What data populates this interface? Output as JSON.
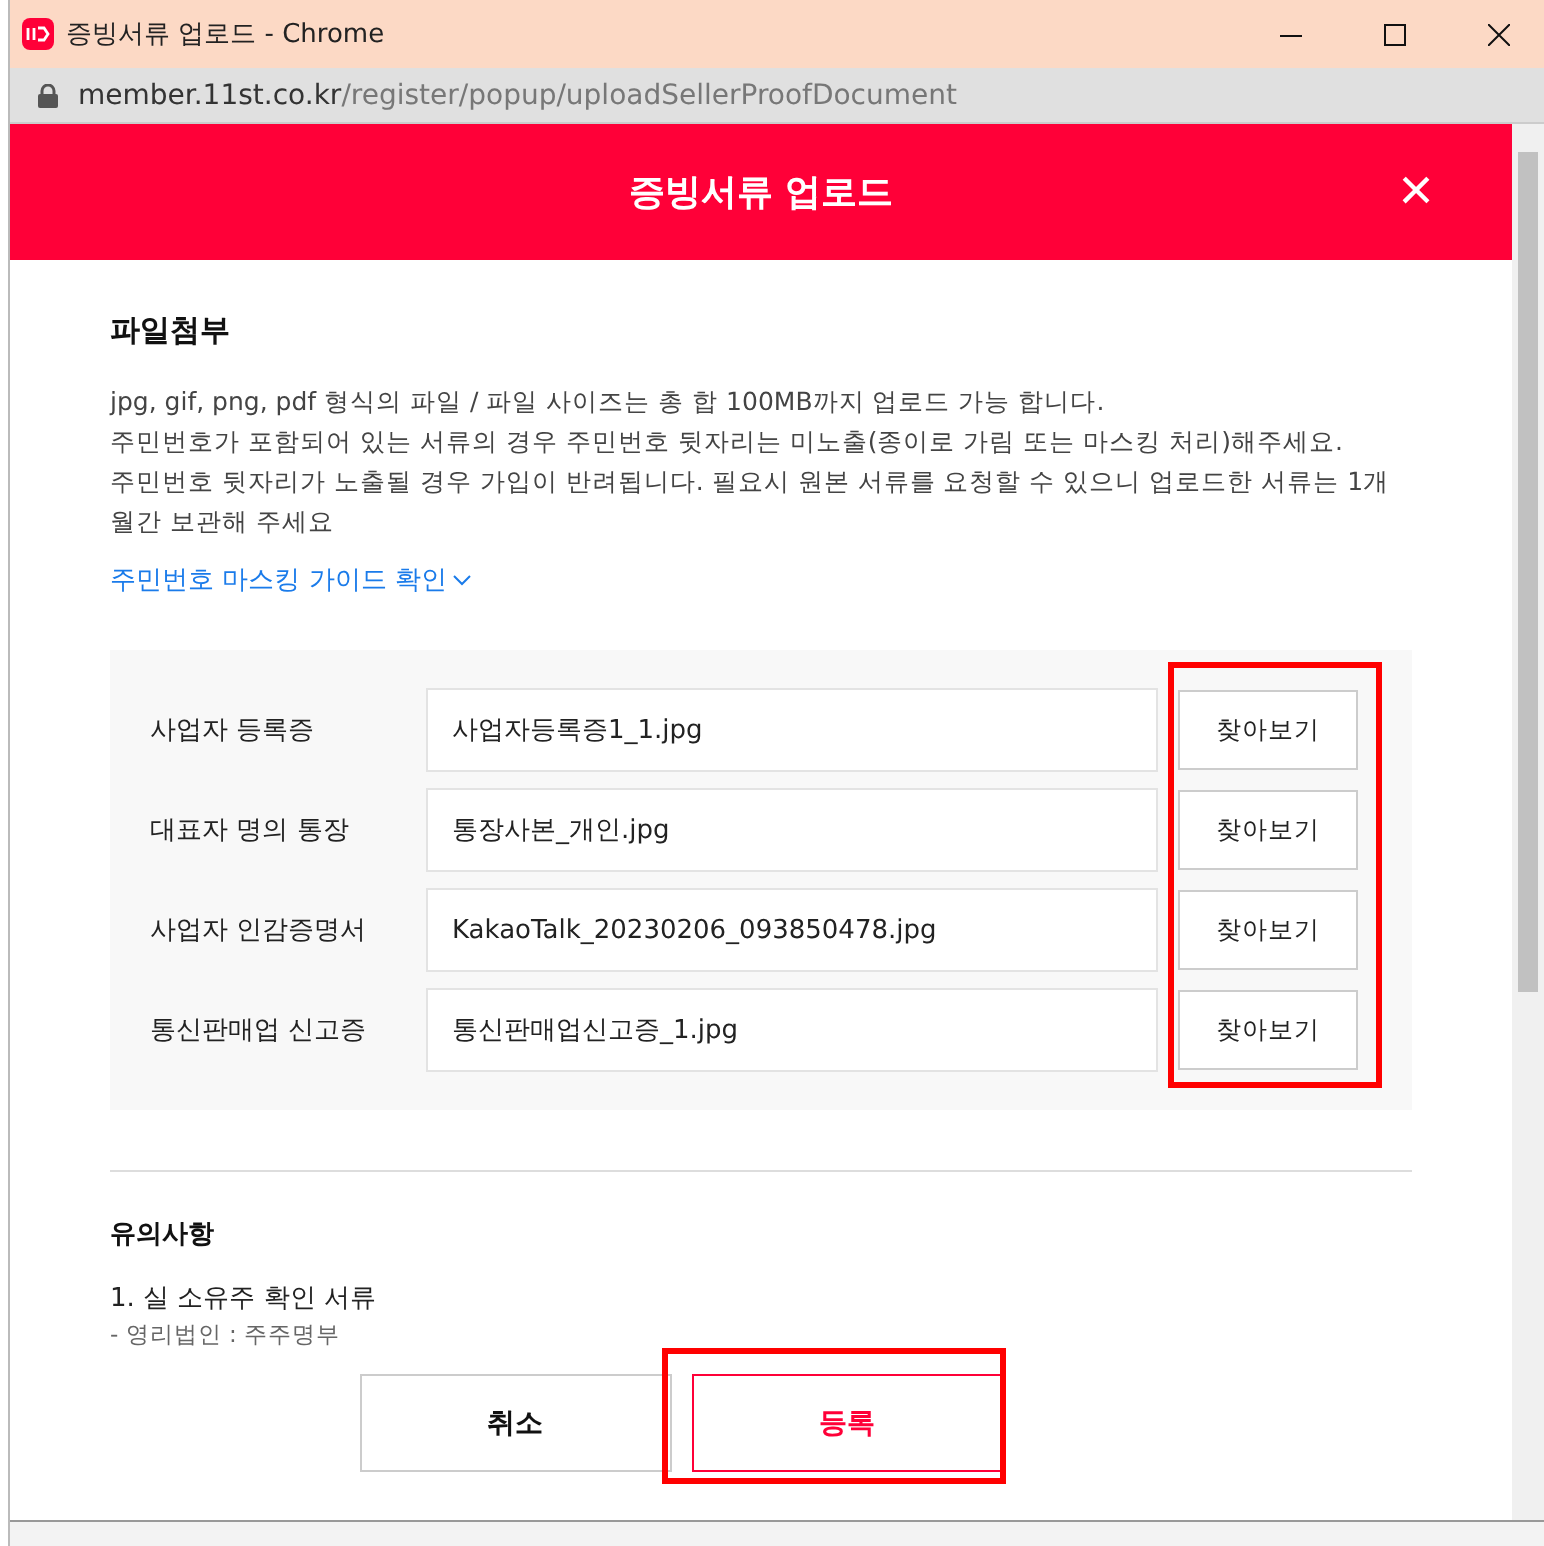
{
  "window": {
    "title": "증빙서류 업로드 - Chrome",
    "url_host": "member.11st.co.kr",
    "url_path": "/register/popup/uploadSellerProofDocument"
  },
  "dialog": {
    "title": "증빙서류 업로드",
    "close": "×"
  },
  "attachment": {
    "heading": "파일첨부",
    "lines": [
      "jpg, gif, png, pdf 형식의 파일 / 파일 사이즈는 총 합 100MB까지 업로드 가능 합니다.",
      "주민번호가 포함되어 있는 서류의 경우 주민번호 뒷자리는 미노출(종이로 가림 또는 마스킹 처리)해주세요.",
      "주민번호 뒷자리가 노출될 경우 가입이 반려됩니다. 필요시 원본 서류를 요청할 수 있으니 업로드한 서류는 1개월간 보관해 주세요"
    ],
    "guide_link": "주민번호 마스킹 가이드 확인"
  },
  "files": [
    {
      "label": "사업자 등록증",
      "value": "사업자등록증1_1.jpg",
      "button": "찾아보기"
    },
    {
      "label": "대표자 명의 통장",
      "value": "통장사본_개인.jpg",
      "button": "찾아보기"
    },
    {
      "label": "사업자 인감증명서",
      "value": "KakaoTalk_20230206_093850478.jpg",
      "button": "찾아보기"
    },
    {
      "label": "통신판매업 신고증",
      "value": "통신판매업신고증_1.jpg",
      "button": "찾아보기"
    }
  ],
  "notes": {
    "heading": "유의사항",
    "item": "1. 실 소유주 확인 서류",
    "sub": "- 영리법인 : 주주명부"
  },
  "buttons": [
    {
      "label": "취소",
      "kind": "secondary"
    },
    {
      "label": "등록",
      "kind": "primary"
    }
  ]
}
